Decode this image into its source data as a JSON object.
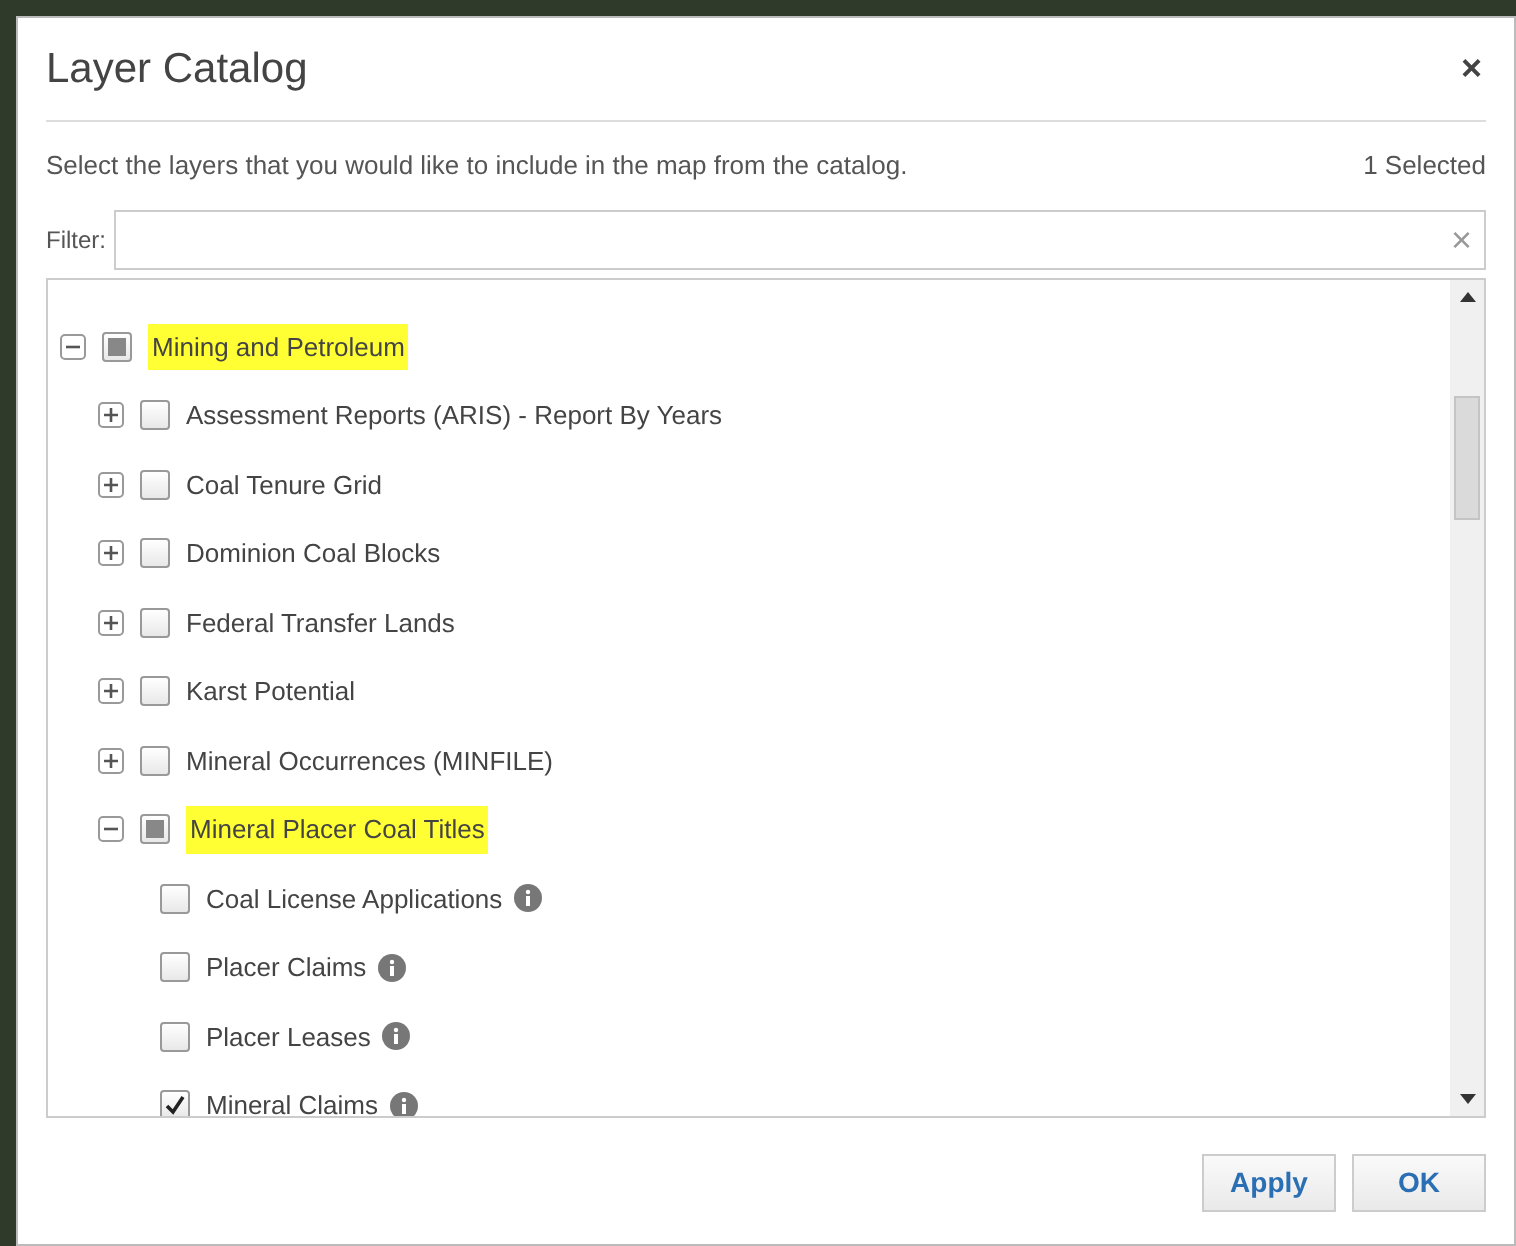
{
  "dialog": {
    "title": "Layer Catalog",
    "close": "×",
    "description": "Select the layers that you would like to include in the map from the catalog.",
    "selected_count": "1 Selected"
  },
  "filter": {
    "label": "Filter:",
    "clear": "×"
  },
  "tree": [
    {
      "label": "Mining and Petroleum",
      "expanded": true,
      "checked": false,
      "partial": true,
      "highlighted": true,
      "children": [
        {
          "label": "Assessment Reports (ARIS) - Report By Years",
          "expanded": false,
          "checked": false,
          "partial": false,
          "highlighted": false
        },
        {
          "label": "Coal Tenure Grid",
          "expanded": false,
          "checked": false,
          "partial": false,
          "highlighted": false
        },
        {
          "label": "Dominion Coal Blocks",
          "expanded": false,
          "checked": false,
          "partial": false,
          "highlighted": false
        },
        {
          "label": "Federal Transfer Lands",
          "expanded": false,
          "checked": false,
          "partial": false,
          "highlighted": false
        },
        {
          "label": "Karst Potential",
          "expanded": false,
          "checked": false,
          "partial": false,
          "highlighted": false
        },
        {
          "label": "Mineral Occurrences (MINFILE)",
          "expanded": false,
          "checked": false,
          "partial": false,
          "highlighted": false
        },
        {
          "label": "Mineral Placer Coal Titles",
          "expanded": true,
          "checked": false,
          "partial": true,
          "highlighted": true,
          "children": [
            {
              "label": "Coal License Applications",
              "checked": false,
              "highlighted": false,
              "info": true
            },
            {
              "label": "Placer Claims",
              "checked": false,
              "highlighted": false,
              "info": true
            },
            {
              "label": "Placer Leases",
              "checked": false,
              "highlighted": false,
              "info": true
            },
            {
              "label": "Mineral Claims",
              "checked": true,
              "highlighted": false,
              "info": true
            }
          ]
        }
      ]
    }
  ],
  "buttons": [
    {
      "label": "Apply"
    },
    {
      "label": "OK"
    }
  ]
}
